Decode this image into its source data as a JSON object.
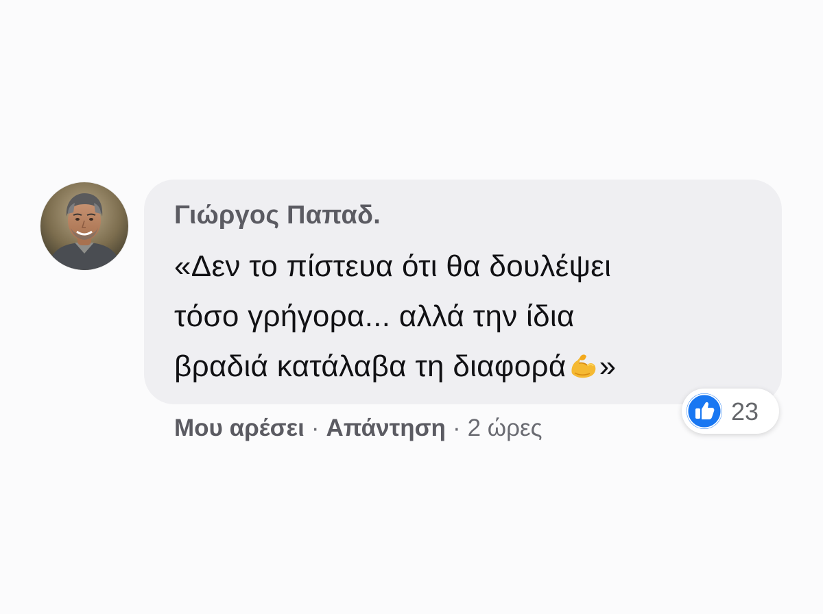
{
  "comment": {
    "author": "Γιώργος Παπαδ.",
    "text_lines": [
      "«Δεν το πίστευα ότι θα δουλέψει",
      "τόσο γρήγορα... αλλά την ίδια",
      "βραδιά κατάλαβα τη διαφορά"
    ],
    "text_end": "»",
    "emoji": "flexed-biceps",
    "avatar_icon": "user-avatar-photo",
    "bubble_color": "#efeff2"
  },
  "actions": {
    "like_label": "Μου αρέσει",
    "separator": "·",
    "reply_label": "Απάντηση",
    "timestamp": "2 ώρες"
  },
  "reactions": {
    "icon": "thumbs-up-icon",
    "count": "23",
    "accent_color": "#1877f2"
  }
}
